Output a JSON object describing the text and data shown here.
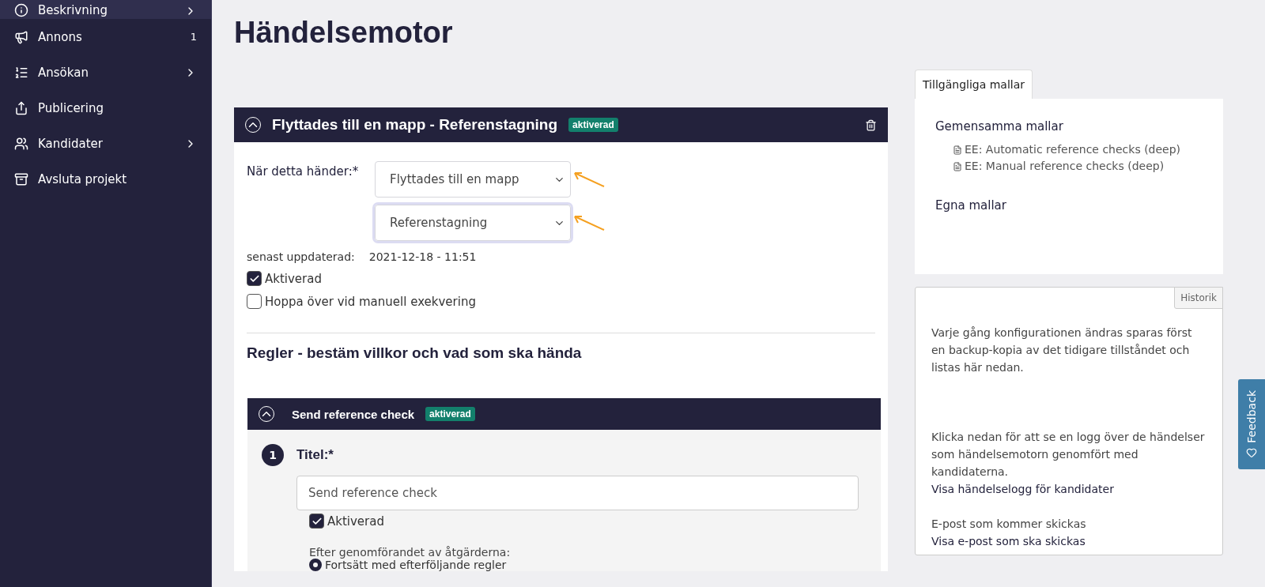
{
  "sidebar": {
    "items": [
      {
        "label": "Beskrivning",
        "kind": "info",
        "selected": true,
        "chevron": true
      },
      {
        "label": "Annons",
        "kind": "megaphone",
        "selected": false,
        "chevron": false,
        "count": "1"
      },
      {
        "label": "Ansökan",
        "kind": "list",
        "selected": false,
        "chevron": true
      },
      {
        "label": "Publicering",
        "kind": "share",
        "selected": false,
        "chevron": false
      },
      {
        "label": "Kandidater",
        "kind": "users",
        "selected": false,
        "chevron": true
      },
      {
        "label": "Avsluta projekt",
        "kind": "archive",
        "selected": false,
        "chevron": false
      }
    ]
  },
  "page_title": "Händelsemotor",
  "event": {
    "title": "Flyttades till en mapp  - Referenstagning",
    "badge": "aktiverad",
    "trigger_label": "När detta händer:*",
    "selects": [
      {
        "value": "Flyttades till en mapp",
        "focused": false
      },
      {
        "value": "Referenstagning",
        "focused": true
      }
    ],
    "updated_label": "senast uppdaterad:",
    "updated_value": "2021-12-18 - 11:51",
    "checkboxes": [
      {
        "label": "Aktiverad",
        "checked": true
      },
      {
        "label": "Hoppa över vid manuell exekvering",
        "checked": false
      }
    ],
    "rules_heading": "Regler - bestäm villkor och vad som ska hända",
    "rule": {
      "title": "Send reference check",
      "badge": "aktiverad",
      "step": "1",
      "field_label": "Titel:*",
      "field_value": "Send reference check",
      "checkbox": {
        "label": "Aktiverad",
        "checked": true
      },
      "after_label": "Efter genomförandet av åtgärderna:",
      "radio": {
        "label": "Fortsätt med efterföljande regler",
        "selected": true
      }
    }
  },
  "templates": {
    "tab": "Tillgängliga mallar",
    "groups": [
      {
        "heading": "Gemensamma mallar",
        "items": [
          "EE: Automatic reference checks (deep)",
          "EE: Manual reference checks (deep)"
        ]
      },
      {
        "heading": "Egna mallar"
      }
    ]
  },
  "history": {
    "tab": "Historik",
    "intro": "Varje gång konfigurationen ändras sparas först en backup-kopia av det tidigare tillståndet och listas här nedan.",
    "log_text": "Klicka nedan för att se en logg över de händelser som händelsemotorn genomfört med kandidaterna.",
    "log_link": "Visa händelselogg för kandidater",
    "mail_text": "E-post som kommer skickas",
    "mail_link": "Visa e-post som ska skickas"
  },
  "feedback": "Feedback"
}
